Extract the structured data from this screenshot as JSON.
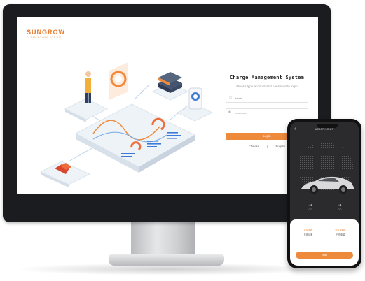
{
  "brand": {
    "logo": "SUNGROW",
    "tagline": "CLEAN POWER FOR ALL"
  },
  "login": {
    "title": "Charge Management System",
    "subtitle": "Please type account and password to login",
    "username_value": "admin",
    "password_value": "••••••••••••",
    "button_label": "Login",
    "lang_chinese": "Chinese",
    "lang_separator": "|",
    "lang_english": "English"
  },
  "phone": {
    "title": "AC007K-CN-T",
    "back_icon": "chevron-left-icon",
    "stat_left": "0.0",
    "stat_right": "0.0",
    "metric_left_value": "0.0 kW",
    "metric_left_label": "充电功率",
    "metric_right_value": "0.0 kWh",
    "metric_right_label": "已充电量",
    "button_label": "Start"
  },
  "colors": {
    "accent": "#ee8a3c",
    "brand": "#e8792b",
    "bezel": "#1b1c1f",
    "phone_screen": "#2b2b2e"
  }
}
